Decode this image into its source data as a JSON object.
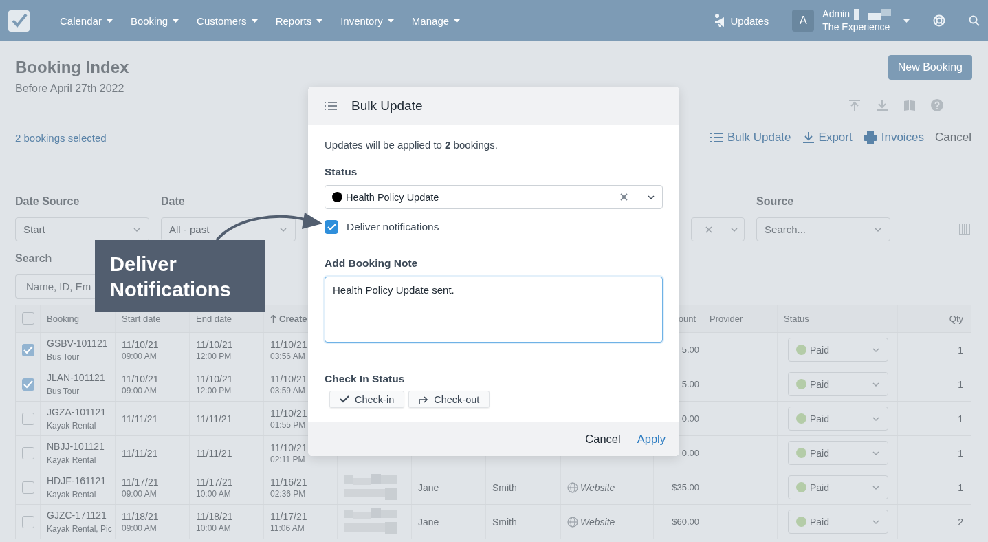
{
  "nav": {
    "items": [
      {
        "label": "Calendar"
      },
      {
        "label": "Booking"
      },
      {
        "label": "Customers"
      },
      {
        "label": "Reports"
      },
      {
        "label": "Inventory"
      },
      {
        "label": "Manage"
      }
    ],
    "updates": "Updates",
    "avatar": "A",
    "user_name": "Admin",
    "account": "The Experience"
  },
  "page": {
    "title": "Booking Index",
    "subtitle": "Before April 27th 2022",
    "new_button": "New Booking",
    "selection": "2 bookings selected",
    "actions": [
      {
        "kind": "bulk",
        "label": "Bulk Update"
      },
      {
        "kind": "export",
        "label": "Export"
      },
      {
        "kind": "invoices",
        "label": "Invoices"
      },
      {
        "kind": "cancel",
        "label": "Cancel"
      }
    ]
  },
  "filters": [
    {
      "kind": "select",
      "label": "Date Source",
      "value": "Start"
    },
    {
      "kind": "select",
      "label": "Date",
      "value": "All - past"
    },
    {
      "kind": "clearable"
    },
    {
      "kind": "select",
      "label": "Source",
      "placeholder": "Search..."
    }
  ],
  "search": {
    "label": "Search",
    "placeholder": "Name, ID, Em"
  },
  "table": {
    "all_selected": false,
    "columns": [
      {
        "kind": "booking",
        "label": "Booking",
        "sorted": false
      },
      {
        "kind": "start",
        "label": "Start date",
        "sorted": false
      },
      {
        "kind": "end",
        "label": "End date",
        "sorted": false
      },
      {
        "kind": "created",
        "label": "Create",
        "sorted": true
      },
      {
        "kind": "amount",
        "label": "ount",
        "sorted": false
      },
      {
        "kind": "provider",
        "label": "Provider",
        "sorted": false
      },
      {
        "kind": "status",
        "label": "Status",
        "sorted": false
      },
      {
        "kind": "qty",
        "label": "Qty",
        "sorted": false
      }
    ],
    "rows": [
      {
        "selected": true,
        "booking": "GSBV-101121",
        "product": "Bus Tour",
        "start_date": "11/10/21",
        "start_time": "09:00 AM",
        "end_date": "11/10/21",
        "end_time": "12:00 PM",
        "created_date": "11/10/21",
        "created_time": "03:56 AM",
        "amount": "5.00",
        "status": "Paid",
        "qty": "1"
      },
      {
        "selected": true,
        "booking": "JLAN-101121",
        "product": "Bus Tour",
        "start_date": "11/10/21",
        "start_time": "09:00 AM",
        "end_date": "11/10/21",
        "end_time": "12:00 PM",
        "created_date": "11/10/21",
        "created_time": "03:59 AM",
        "amount": "5.00",
        "status": "Paid",
        "qty": "1"
      },
      {
        "selected": false,
        "booking": "JGZA-101121",
        "product": "Kayak Rental",
        "start_date": "11/11/21",
        "end_date": "11/11/21",
        "created_date": "11/10/21",
        "created_time": "01:55 PM",
        "amount": "0.00",
        "status": "Paid",
        "qty": "1"
      },
      {
        "selected": false,
        "booking": "NBJJ-101121",
        "product": "Kayak Rental",
        "start_date": "11/11/21",
        "end_date": "11/11/21",
        "created_date": "11/10/21",
        "created_time": "02:11 PM",
        "amount": "0.00",
        "status": "Paid",
        "qty": "1"
      },
      {
        "selected": false,
        "booking": "HDJF-161121",
        "product": "Kayak Rental",
        "start_date": "11/17/21",
        "start_time": "09:00 AM",
        "end_date": "11/17/21",
        "end_time": "10:00 AM",
        "created_date": "11/16/21",
        "created_time": "02:36 PM",
        "customer_blurred": true,
        "first_name": "Jane",
        "last_name": "Smith",
        "source": "Website",
        "amount": "$35.00",
        "status": "Paid",
        "qty": "1"
      },
      {
        "selected": false,
        "booking": "GJZC-171121",
        "product": "Kayak Rental, Pic",
        "start_date": "11/18/21",
        "start_time": "09:00 AM",
        "end_date": "11/18/21",
        "end_time": "10:00 AM",
        "created_date": "11/17/21",
        "created_time": "11:06 AM",
        "customer_blurred": true,
        "first_name": "Jane",
        "last_name": "Smith",
        "source": "Website",
        "amount": "$60.00",
        "status": "Paid",
        "qty": "2"
      }
    ]
  },
  "bulk_update": {
    "title": "Bulk Update",
    "intro": "Updates will be applied to **2** bookings.",
    "status_label": "Status",
    "status_value": "Health Policy Update",
    "notify": {
      "label": "Deliver notifications",
      "checked": true
    },
    "note_label": "Add Booking Note",
    "note_value": "Health Policy Update sent.",
    "checkin_label": "Check In Status",
    "checkin_buttons": [
      {
        "kind": "check-in",
        "label": "Check-in"
      },
      {
        "kind": "check-out",
        "label": "Check-out"
      }
    ],
    "cancel": "Cancel",
    "apply": "Apply"
  },
  "callout": {
    "text": "Deliver Notifications"
  }
}
